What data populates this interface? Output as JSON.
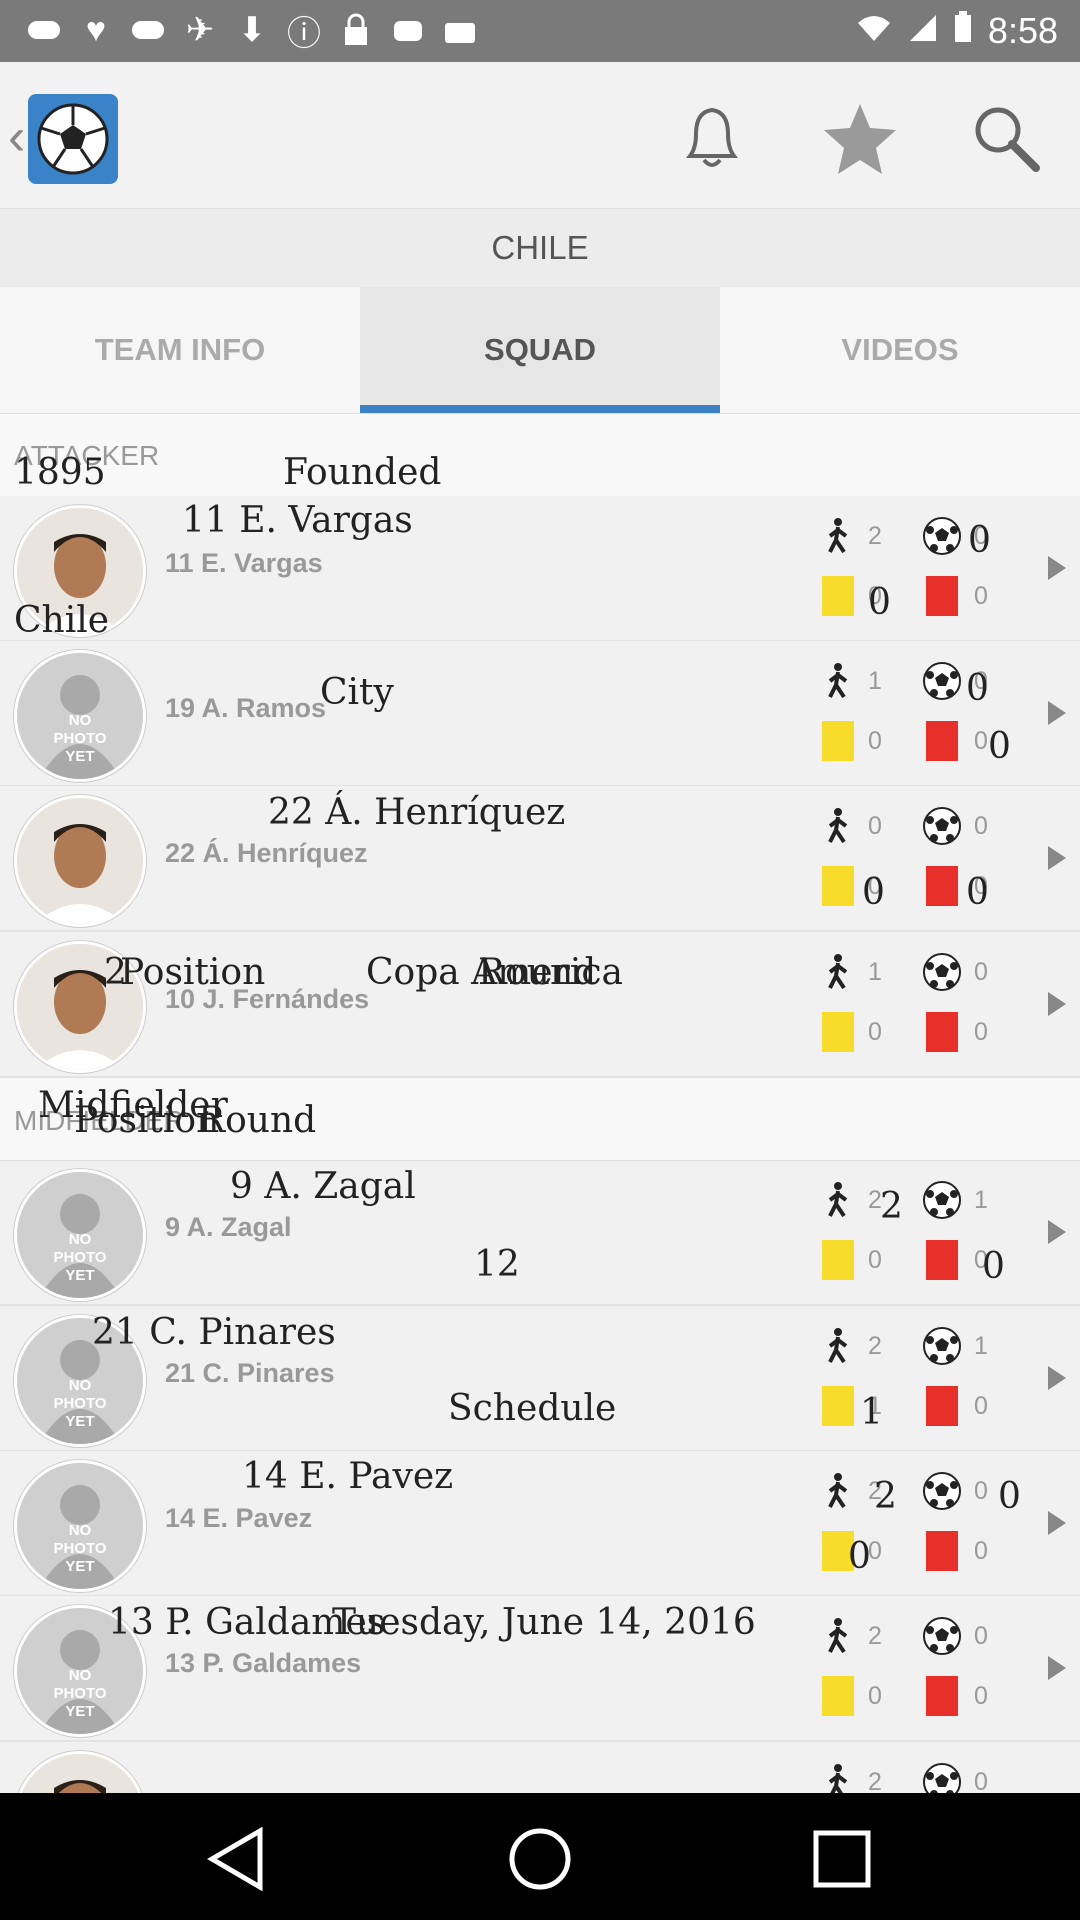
{
  "status_bar": {
    "time": "8:58",
    "left_icons": [
      "game-controller-icon",
      "heart-icon",
      "game-controller-icon",
      "satellite-fake-gps-icon",
      "lock-download-icon",
      "info-icon",
      "lock-icon",
      "android-icon",
      "briefcase-icon"
    ]
  },
  "app_bar": {
    "icons": [
      "back-icon",
      "soccer-logo-icon",
      "bell-icon",
      "star-icon",
      "search-icon"
    ]
  },
  "country": "CHILE",
  "tabs": [
    {
      "label": "TEAM INFO",
      "active": false
    },
    {
      "label": "SQUAD",
      "active": true
    },
    {
      "label": "VIDEOS",
      "active": false
    }
  ],
  "sections": {
    "attacker": "ATTACKER",
    "midfielder": "MIDFIELDER"
  },
  "players": [
    {
      "name": "11 E. Vargas",
      "apps": "2",
      "goals": "0",
      "yellow": "0",
      "red": "0",
      "photo": "face"
    },
    {
      "name": "19 A. Ramos",
      "apps": "1",
      "goals": "0",
      "yellow": "0",
      "red": "0",
      "photo": "none"
    },
    {
      "name": "22 Á. Henríquez",
      "apps": "0",
      "goals": "0",
      "yellow": "0",
      "red": "0",
      "photo": "face"
    },
    {
      "name": "10 J. Fernándes",
      "apps": "1",
      "goals": "0",
      "yellow": "0",
      "red": "0",
      "photo": "face"
    },
    {
      "name": "9 A. Zagal",
      "apps": "2",
      "goals": "1",
      "yellow": "0",
      "red": "0",
      "photo": "none"
    },
    {
      "name": "21 C. Pinares",
      "apps": "2",
      "goals": "1",
      "yellow": "1",
      "red": "0",
      "photo": "none"
    },
    {
      "name": "14 E. Pavez",
      "apps": "2",
      "goals": "0",
      "yellow": "0",
      "red": "0",
      "photo": "none"
    },
    {
      "name": "13 P. Galdames",
      "apps": "2",
      "goals": "0",
      "yellow": "0",
      "red": "0",
      "photo": "none"
    },
    {
      "name": "",
      "apps": "2",
      "goals": "0",
      "yellow": "",
      "red": "",
      "photo": "face"
    }
  ],
  "no_photo_text": "NO PHOTO YET",
  "overlay": {
    "year": "1895",
    "founded": "Founded",
    "n1": "11 E. Vargas",
    "zero_a": "0",
    "chile": "Chile",
    "zero_b": "0",
    "city": "City",
    "zero_c": "0",
    "zero_d": "0",
    "n3": "22 Á. Henríquez",
    "zero_e": "0",
    "zero_f": "0",
    "two": "2",
    "position": "Position",
    "copa": "Copa America",
    "round": "Round",
    "midfielder": "Midfielder",
    "position2": "Position",
    "round2": "Round",
    "n5": "9 A. Zagal",
    "two_b": "2",
    "twelve": "12",
    "zero_g": "0",
    "n6": "21 C. Pinares",
    "schedule": "Schedule",
    "one": "1",
    "n7": "14 E. Pavez",
    "two_c": "2",
    "zero_h": "0",
    "zero_i": "0",
    "n8": "13 P. Galdames",
    "date": "Tuesday, June 14, 2016"
  },
  "nav_bar": [
    "back-icon",
    "home-icon",
    "recents-icon"
  ],
  "colors": {
    "accent": "#3b82c4",
    "yellow_card": "#f7dc2b",
    "red_card": "#e8302b"
  }
}
